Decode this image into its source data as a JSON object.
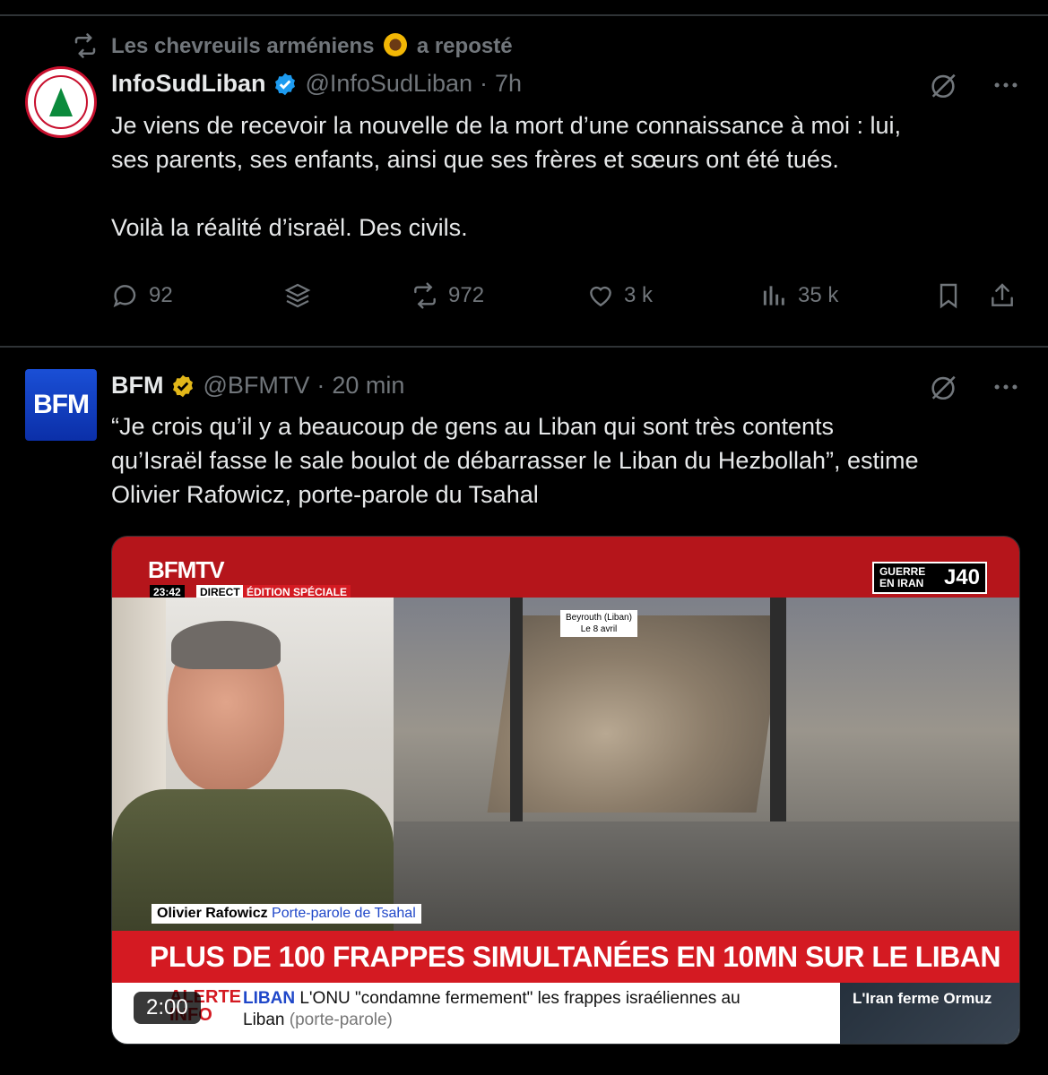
{
  "repost": {
    "text_before": "Les chevreuils arméniens",
    "text_after": "a reposté"
  },
  "tweet1": {
    "name": "InfoSudLiban",
    "handle": "@InfoSudLiban",
    "separator": "·",
    "time": "7h",
    "text_line1": "Je viens de recevoir la nouvelle de la mort d’une connaissance à moi : lui,",
    "text_line2": "ses parents, ses enfants, ainsi que ses frères et sœurs ont été tués.",
    "text_line3": "Voilà la réalité d’israël. Des civils.",
    "stats": {
      "replies": "92",
      "reposts": "972",
      "likes": "3 k",
      "views": "35 k"
    },
    "verified_color": "#1d9bf0"
  },
  "tweet2": {
    "name": "BFM",
    "handle": "@BFMTV",
    "separator": "·",
    "time": "20 min",
    "avatar_label": "BFM",
    "text_line1": "“Je crois qu’il y a beaucoup de gens au Liban qui sont très contents",
    "text_line2": "qu’Israël fasse le sale boulot de débarrasser le Liban du Hezbollah”, estime",
    "text_line3": "Olivier Rafowicz, porte-parole du Tsahal",
    "verified_color": "#e2b719",
    "video": {
      "channel": "BFMTV",
      "clock": "23:42",
      "direct": "DIRECT",
      "edition": "ÉDITION SPÉCIALE",
      "guerre_label": "GUERRE EN IRAN",
      "guerre_day": "J40",
      "location": "Beyrouth",
      "location_country": "(Liban)",
      "location_date": "Le 8 avril",
      "speaker_name": "Olivier Rafowicz",
      "speaker_role": "Porte-parole de Tsahal",
      "headline": "PLUS DE 100 FRAPPES SIMULTANÉES EN 10MN SUR LE LIBAN",
      "alert_label": "ALERTE INFO",
      "ticker_tag": "LIBAN",
      "ticker_text": "L'ONU \"condamne fermement\" les frappes israéliennes au",
      "ticker_text2": "Liban",
      "ticker_source": "(porte-parole)",
      "side_text": "L'Iran ferme Ormuz",
      "duration": "2:00"
    }
  },
  "icons": [
    "repost-icon",
    "verified-badge-icon",
    "grok-icon",
    "more-icon",
    "reply-icon",
    "stack-icon",
    "repost-icon",
    "like-icon",
    "views-icon",
    "bookmark-icon",
    "share-icon"
  ]
}
